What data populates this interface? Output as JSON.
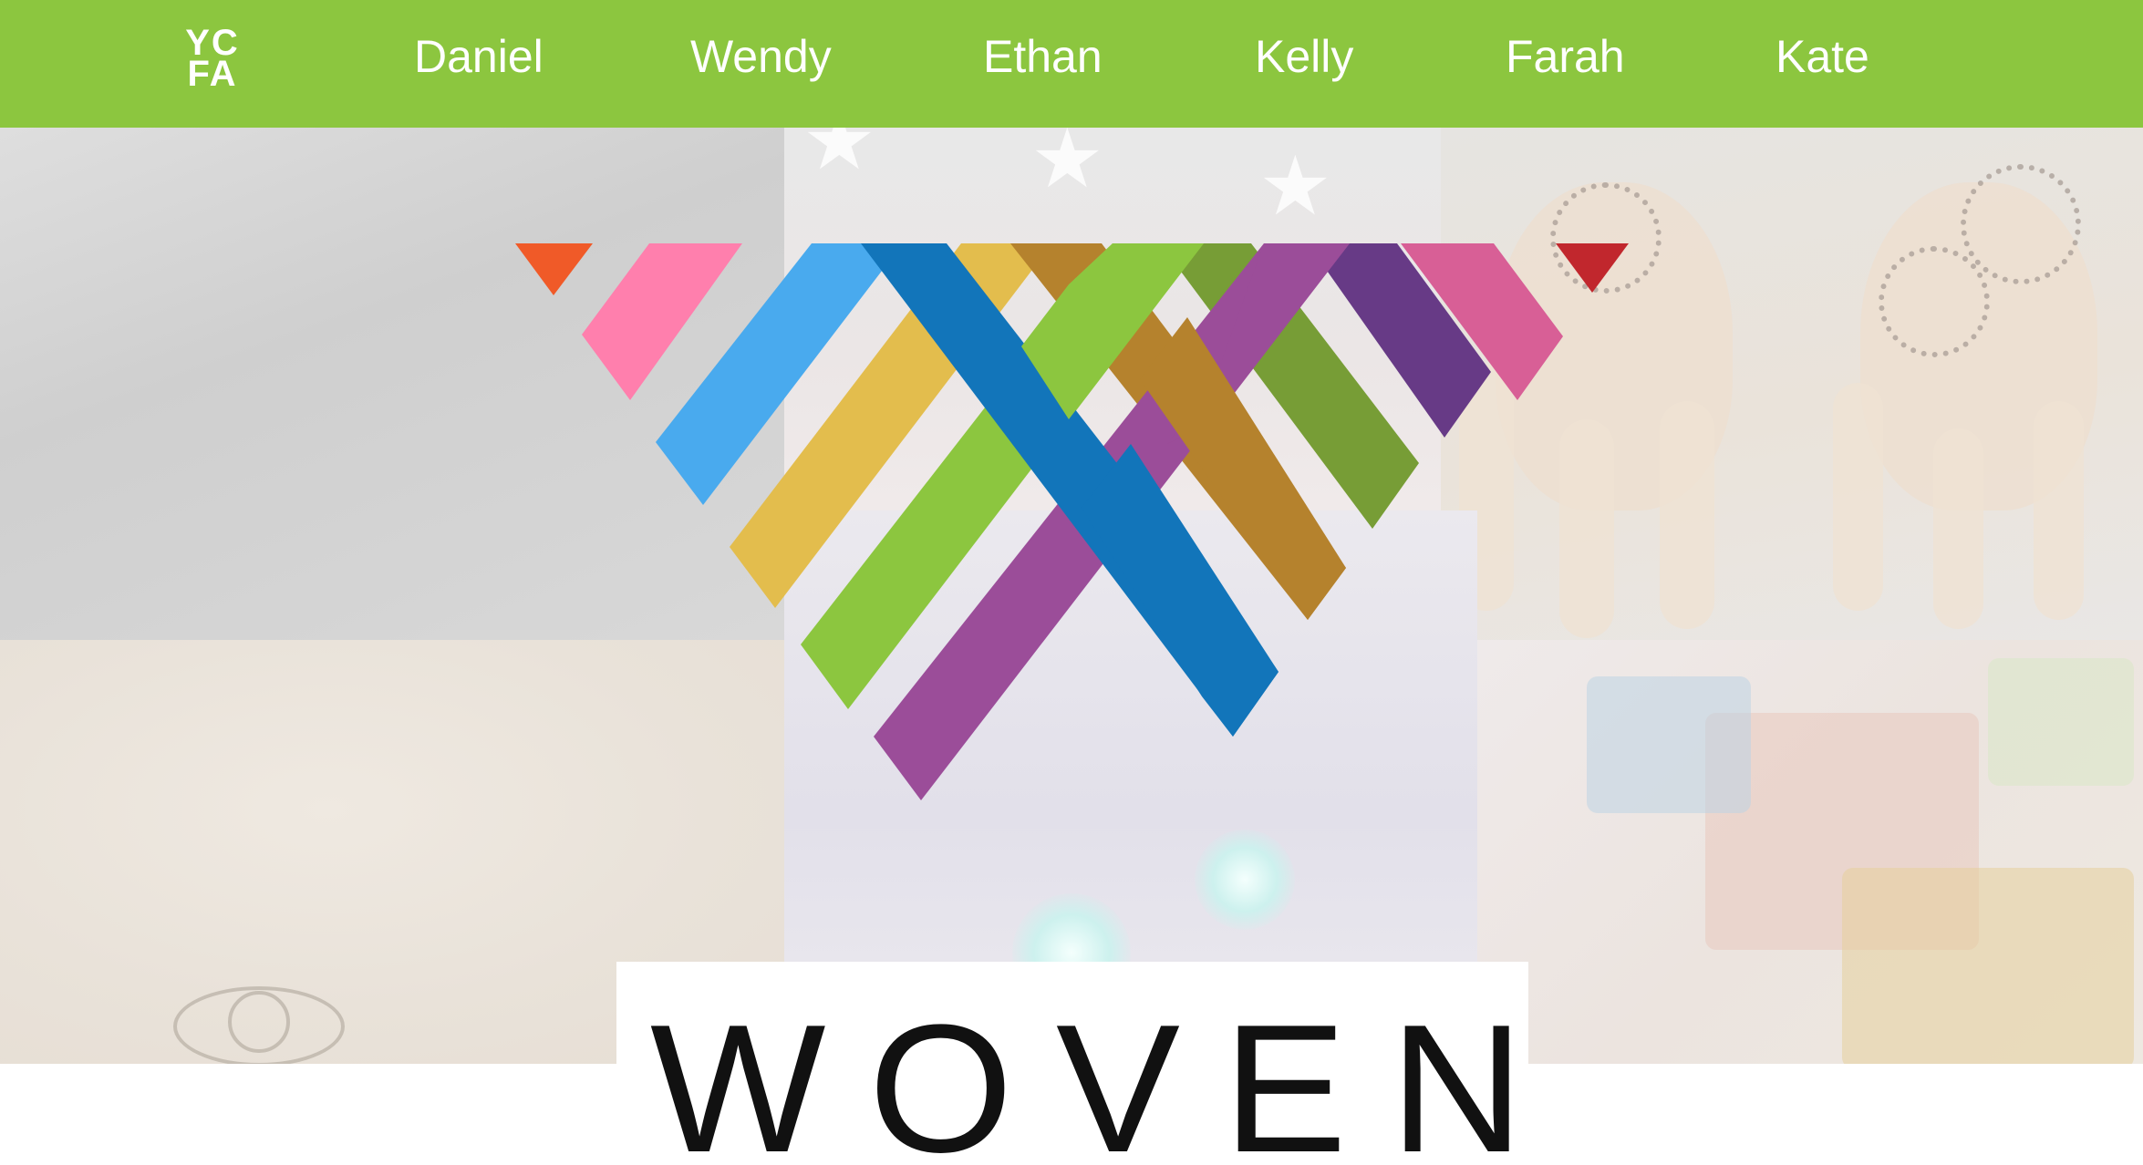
{
  "nav": {
    "logo_top": "YC",
    "logo_bottom": "FA",
    "items": [
      "Daniel",
      "Wendy",
      "Ethan",
      "Kelly",
      "Farah",
      "Kate"
    ],
    "background_color": "#8cc63f",
    "text_color": "#ffffff"
  },
  "hero": {
    "wordmark": "WOVEN",
    "logo_colors": {
      "orange": "#f05a28",
      "pink": "#ff7fad",
      "light_blue": "#49aaee",
      "dark_blue": "#1275ba",
      "yellow": "#e3bd4d",
      "brown": "#b5822d",
      "green": "#8cc63f",
      "dark_green": "#779d36",
      "purple": "#9b4d99",
      "dark_purple": "#673a86",
      "magenta": "#d85f96",
      "red": "#c1272d"
    }
  }
}
